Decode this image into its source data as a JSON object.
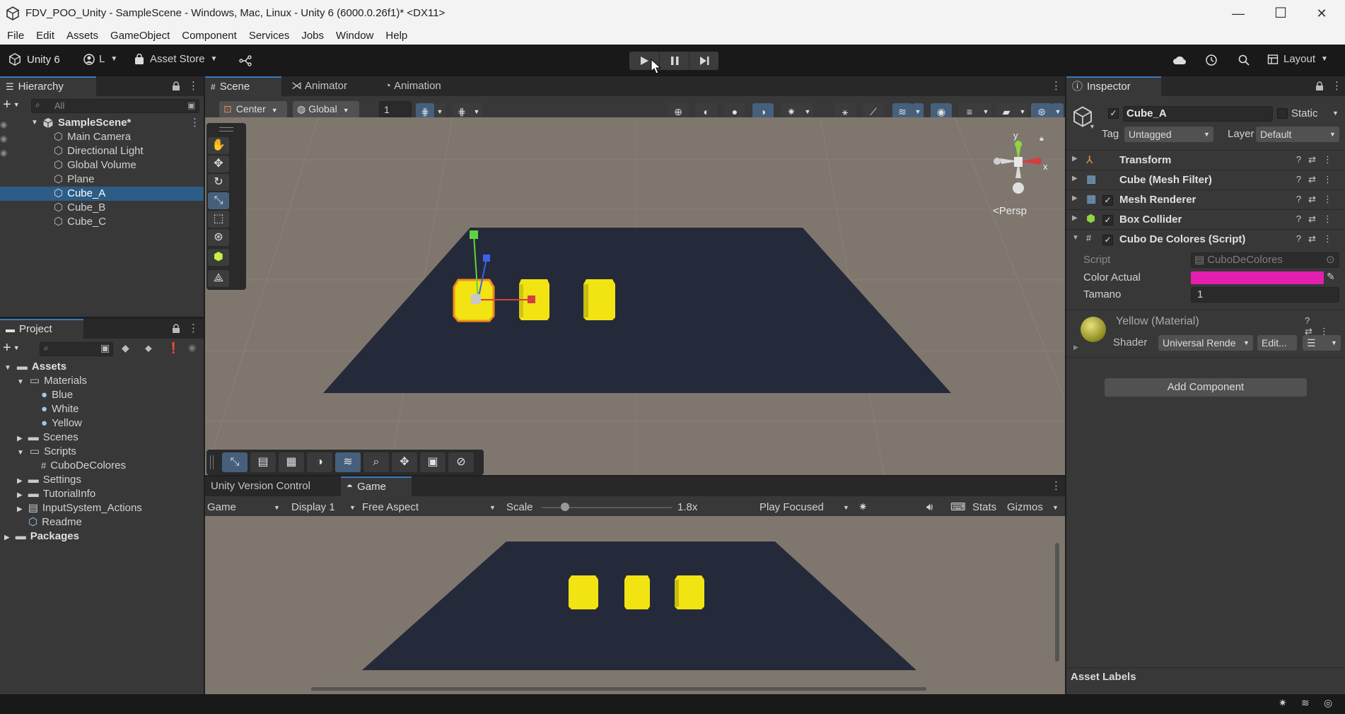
{
  "window": {
    "title": "FDV_POO_Unity - SampleScene - Windows, Mac, Linux - Unity 6 (6000.0.26f1)* <DX11>",
    "minimize": "—",
    "maximize": "☐",
    "close": "✕"
  },
  "menu": [
    "File",
    "Edit",
    "Assets",
    "GameObject",
    "Component",
    "Services",
    "Jobs",
    "Window",
    "Help"
  ],
  "toolbar": {
    "brand": "Unity 6",
    "account": "L",
    "asset_store": "Asset Store",
    "layout": "Layout"
  },
  "hierarchy": {
    "tab": "Hierarchy",
    "search_placeholder": "All",
    "scene": "SampleScene*",
    "items": [
      "Main Camera",
      "Directional Light",
      "Global Volume",
      "Plane",
      "Cube_A",
      "Cube_B",
      "Cube_C"
    ],
    "selected": "Cube_A"
  },
  "project": {
    "tab": "Project",
    "assets": "Assets",
    "materials": "Materials",
    "material_items": [
      "Blue",
      "White",
      "Yellow"
    ],
    "scenes": "Scenes",
    "scripts": "Scripts",
    "script_item": "CuboDeColores",
    "settings": "Settings",
    "tutorial": "TutorialInfo",
    "input": "InputSystem_Actions",
    "readme": "Readme",
    "packages": "Packages"
  },
  "scene_view": {
    "tabs": [
      "Scene",
      "Animator",
      "Animation"
    ],
    "pivot": "Center",
    "space": "Global",
    "snap_value": "1",
    "persp": "Persp",
    "gizmo_y": "y",
    "gizmo_x": "x"
  },
  "game_view": {
    "tabs": [
      "Unity Version Control",
      "Game"
    ],
    "mode": "Game",
    "display": "Display 1",
    "aspect": "Free Aspect",
    "scale_label": "Scale",
    "scale_value": "1.8x",
    "scale_fraction": 0.18,
    "play_focused": "Play Focused",
    "stats": "Stats",
    "gizmos": "Gizmos"
  },
  "inspector": {
    "tab": "Inspector",
    "object_name": "Cube_A",
    "static": "Static",
    "tag_label": "Tag",
    "tag_value": "Untagged",
    "layer_label": "Layer",
    "layer_value": "Default",
    "components": [
      "Transform",
      "Cube (Mesh Filter)",
      "Mesh Renderer",
      "Box Collider",
      "Cubo De Colores (Script)"
    ],
    "script_label": "Script",
    "script_value": "CuboDeColores",
    "color_label": "Color Actual",
    "color_value": "#e41fb0",
    "tamano_label": "Tamano",
    "tamano_value": "1",
    "material_name": "Yellow (Material)",
    "shader_label": "Shader",
    "shader_value": "Universal Rende",
    "edit_btn": "Edit...",
    "add_component": "Add Component",
    "asset_labels": "Asset Labels"
  },
  "colors": {
    "accent": "#3a79bb",
    "selection": "#2c5d87",
    "cube": "#f2e313",
    "plane": "#252a3a",
    "ground": "#7f776e"
  }
}
